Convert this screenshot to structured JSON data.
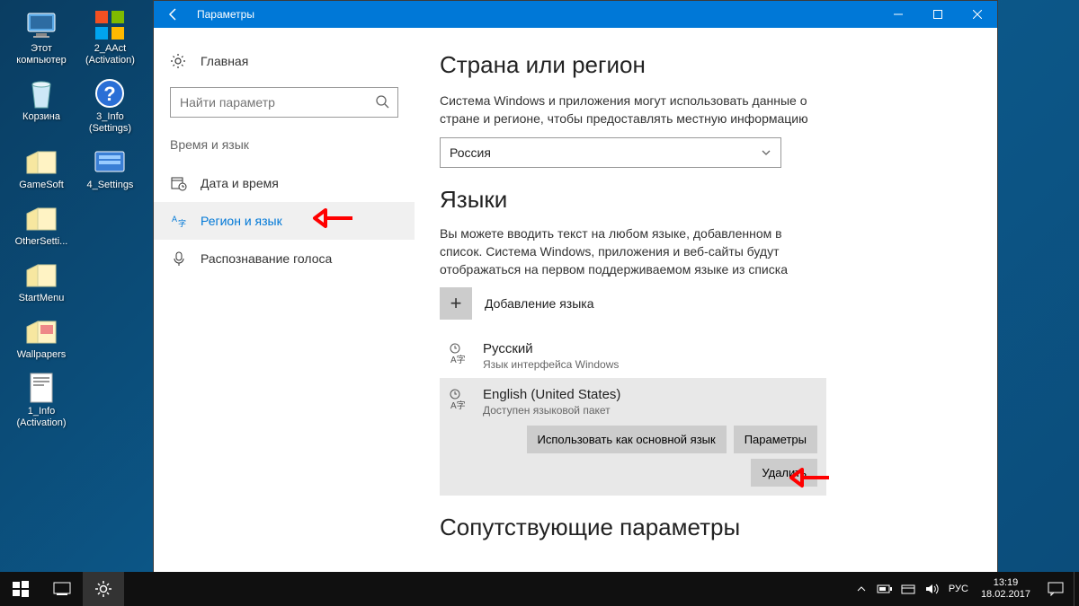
{
  "desktop": {
    "icons": [
      {
        "label": "Этот компьютер"
      },
      {
        "label": "2_AAct (Activation)"
      },
      {
        "label": "Корзина"
      },
      {
        "label": "3_Info (Settings)"
      },
      {
        "label": "GameSoft"
      },
      {
        "label": "4_Settings"
      },
      {
        "label": "OtherSetti..."
      },
      {
        "label": "StartMenu"
      },
      {
        "label": "Wallpapers"
      },
      {
        "label": "1_Info (Activation)"
      }
    ]
  },
  "window": {
    "title": "Параметры",
    "sidebar": {
      "home": "Главная",
      "search_placeholder": "Найти параметр",
      "section": "Время и язык",
      "items": [
        {
          "label": "Дата и время"
        },
        {
          "label": "Регион и язык"
        },
        {
          "label": "Распознавание голоса"
        }
      ]
    },
    "content": {
      "h1": "Страна или регион",
      "region_desc": "Система Windows и приложения могут использовать данные о стране и регионе, чтобы предоставлять местную информацию",
      "region_value": "Россия",
      "h2_lang": "Языки",
      "lang_desc": "Вы можете вводить текст на любом языке, добавленном в список. Система Windows, приложения и веб-сайты будут отображаться на первом поддерживаемом языке из списка",
      "add_lang": "Добавление языка",
      "languages": [
        {
          "name": "Русский",
          "sub": "Язык интерфейса Windows"
        },
        {
          "name": "English (United States)",
          "sub": "Доступен языковой пакет"
        }
      ],
      "btn_default": "Использовать как основной язык",
      "btn_options": "Параметры",
      "btn_remove": "Удалить",
      "h2_related": "Сопутствующие параметры"
    }
  },
  "taskbar": {
    "lang": "РУС",
    "time": "13:19",
    "date": "18.02.2017"
  }
}
